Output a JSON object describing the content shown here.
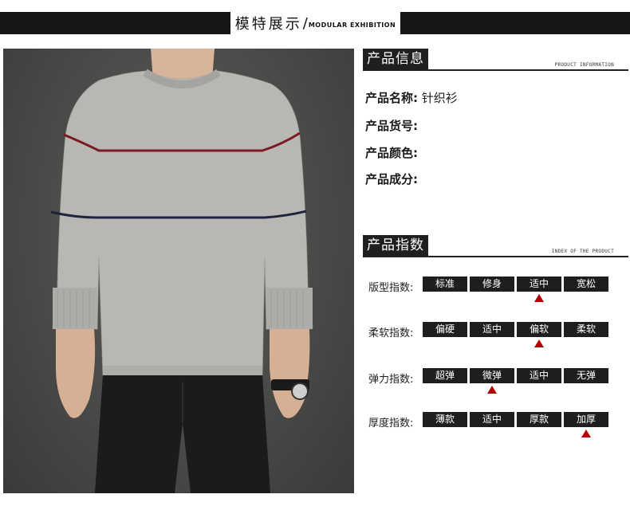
{
  "banner": {
    "title_cn": "模特展示",
    "slash": "/",
    "title_en": "MODULAR EXHIBITION"
  },
  "info_section": {
    "title": "产品信息",
    "subtitle": "PRODUCT INFORMATION",
    "rows": [
      {
        "label": "产品名称:",
        "value": "针织衫"
      },
      {
        "label": "产品货号:",
        "value": ""
      },
      {
        "label": "产品颜色:",
        "value": ""
      },
      {
        "label": "产品成分:",
        "value": ""
      }
    ]
  },
  "index_section": {
    "title": "产品指数",
    "subtitle": "INDEX OF THE PRODUCT",
    "rows": [
      {
        "label": "版型指数:",
        "options": [
          "标准",
          "修身",
          "适中",
          "宽松"
        ],
        "selected_index": 2
      },
      {
        "label": "柔软指数:",
        "options": [
          "偏硬",
          "适中",
          "偏软",
          "柔软"
        ],
        "selected_index": 2
      },
      {
        "label": "弹力指数:",
        "options": [
          "超弹",
          "微弹",
          "适中",
          "无弹"
        ],
        "selected_index": 1
      },
      {
        "label": "厚度指数:",
        "options": [
          "薄款",
          "适中",
          "厚款",
          "加厚"
        ],
        "selected_index": 3
      }
    ]
  },
  "colors": {
    "dark": "#1e1e1e",
    "marker": "#b30000",
    "sweater": "#b9b7b3",
    "stripe_red": "#7a1a22",
    "stripe_navy": "#1e2440"
  }
}
